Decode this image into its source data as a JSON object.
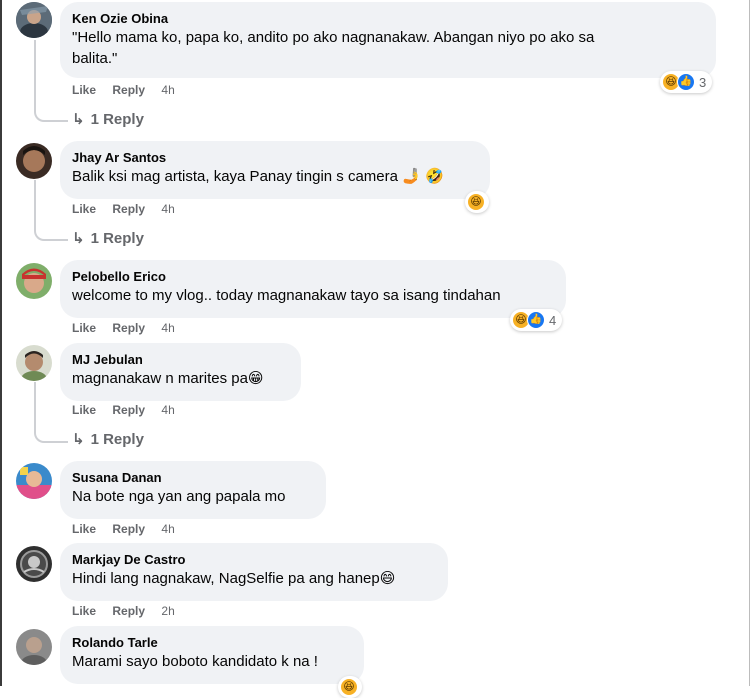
{
  "comments": [
    {
      "author": "Ken Ozie Obina",
      "text_line1": "\"Hello mama ko, papa ko, andito po ako nagnanakaw. Abangan niyo po ako sa",
      "text_line2": "balita.\"",
      "like": "Like",
      "reply": "Reply",
      "time": "4h",
      "reaction_count": "3",
      "replies": "1 Reply",
      "avatar_color": "#4a5a6a"
    },
    {
      "author": "Jhay Ar Santos",
      "text": "Balik ksi mag artista, kaya Panay tingin s camera 🤳 🤣",
      "like": "Like",
      "reply": "Reply",
      "time": "4h",
      "replies": "1 Reply",
      "avatar_color": "#6b4a3a"
    },
    {
      "author": "Pelobello Erico",
      "text": "welcome to my vlog.. today magnanakaw tayo sa isang tindahan",
      "like": "Like",
      "reply": "Reply",
      "time": "4h",
      "reaction_count": "4",
      "avatar_color": "#b03a3a"
    },
    {
      "author": "MJ Jebulan",
      "text": "magnanakaw n marites pa😁",
      "like": "Like",
      "reply": "Reply",
      "time": "4h",
      "replies": "1 Reply",
      "avatar_color": "#8a9a7a"
    },
    {
      "author": "Susana Danan",
      "text": "Na bote nga yan ang papala mo",
      "like": "Like",
      "reply": "Reply",
      "time": "4h",
      "avatar_color": "#3a8acb"
    },
    {
      "author": "Markjay De Castro",
      "text": "Hindi lang nagnakaw, NagSelfie pa ang hanep😄",
      "like": "Like",
      "reply": "Reply",
      "time": "2h",
      "avatar_color": "#2f2f2f"
    },
    {
      "author": "Rolando Tarle",
      "text": "Marami sayo boboto kandidato k na !",
      "avatar_color": "#7a7a7a"
    }
  ]
}
